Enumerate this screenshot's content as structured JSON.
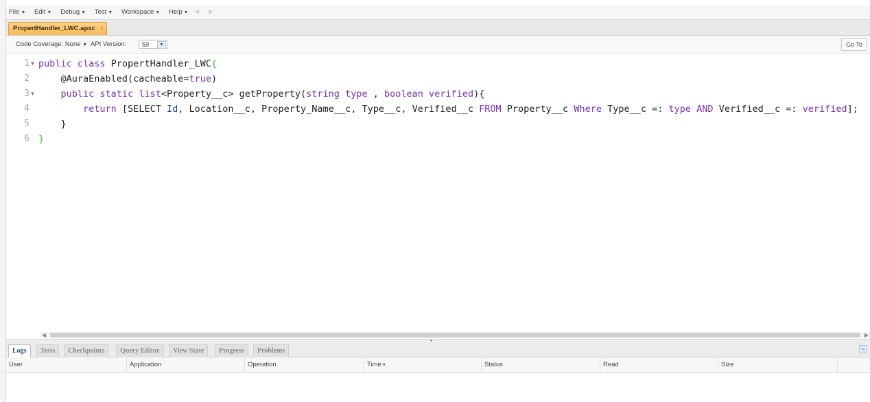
{
  "menu": {
    "items": [
      {
        "label": "File",
        "has_dropdown": true
      },
      {
        "label": "Edit",
        "has_dropdown": true
      },
      {
        "label": "Debug",
        "has_dropdown": true
      },
      {
        "label": "Test",
        "has_dropdown": true
      },
      {
        "label": "Workspace",
        "has_dropdown": true
      },
      {
        "label": "Help",
        "has_dropdown": true
      }
    ],
    "back": "<",
    "forward": ">"
  },
  "file_tab": {
    "label": "PropertHandler_LWC.apxc",
    "close": "×"
  },
  "toolbar": {
    "code_coverage": "Code Coverage: None",
    "api_version_label": "API Version:",
    "api_version_value": "59",
    "goto_label": "Go To"
  },
  "editor": {
    "line_numbers": [
      "1",
      "2",
      "3",
      "4",
      "5",
      "6"
    ]
  },
  "panel": {
    "tabs": [
      "Logs",
      "Tests",
      "Checkpoints",
      "Query Editor",
      "View State",
      "Progress",
      "Problems"
    ],
    "active_tab": "Logs",
    "columns": [
      "User",
      "Application",
      "Operation",
      "Time",
      "Status",
      "Read",
      "Size"
    ],
    "sorted_column": "Time"
  },
  "colors": {
    "keyword": "#7b2fa8",
    "type_keyword": "#1e3fa8",
    "brace_highlight": "#3fbf3f",
    "active_file_tab": "#f6b955",
    "active_panel_tab_text": "#2c4e7c"
  }
}
